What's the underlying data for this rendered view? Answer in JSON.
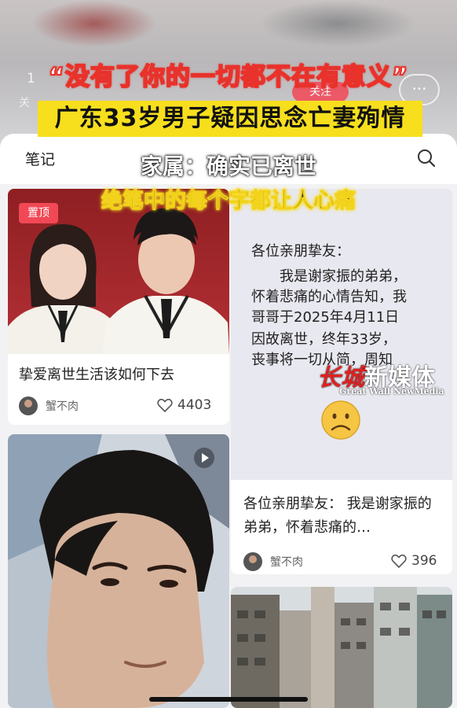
{
  "background": {
    "count": "1",
    "label": "关",
    "follow_label": "关注",
    "more_label": "···"
  },
  "overlay": {
    "line1": "“没有了你的一切都不在有意义”",
    "line2": "广东33岁男子疑因思念亡妻殉情",
    "line3": "家属：确实已离世",
    "line4": "绝笔中的每个字都让人心痛",
    "accent_red": "#e8322b",
    "accent_yellow": "#f7df1e"
  },
  "header": {
    "tab": "笔记",
    "search_icon": "search-icon"
  },
  "posts": [
    {
      "badge": "置顶",
      "title": "挚爱离世生活该如何下去",
      "author": "蟹不肉",
      "likes": "4403"
    },
    {
      "notice_lines": [
        "各位亲朋挚友：",
        "　　我是谢家振的弟弟，",
        "怀着悲痛的心情告知，我",
        "哥哥于2025年4月11日",
        "因故离世，终年33岁，",
        "丧事将一切从简，周知"
      ],
      "emoji": "☹",
      "title": "各位亲朋挚友： 我是谢家振的弟弟，怀着悲痛的…",
      "author": "蟹不肉",
      "likes": "396"
    }
  ],
  "watermark": {
    "cn_red": "长城",
    "cn_white": "新媒体",
    "en": "Great Wall NewMedia"
  },
  "colors": {
    "brand_red": "#f24856",
    "sheet_bg": "#f2f2f4"
  }
}
